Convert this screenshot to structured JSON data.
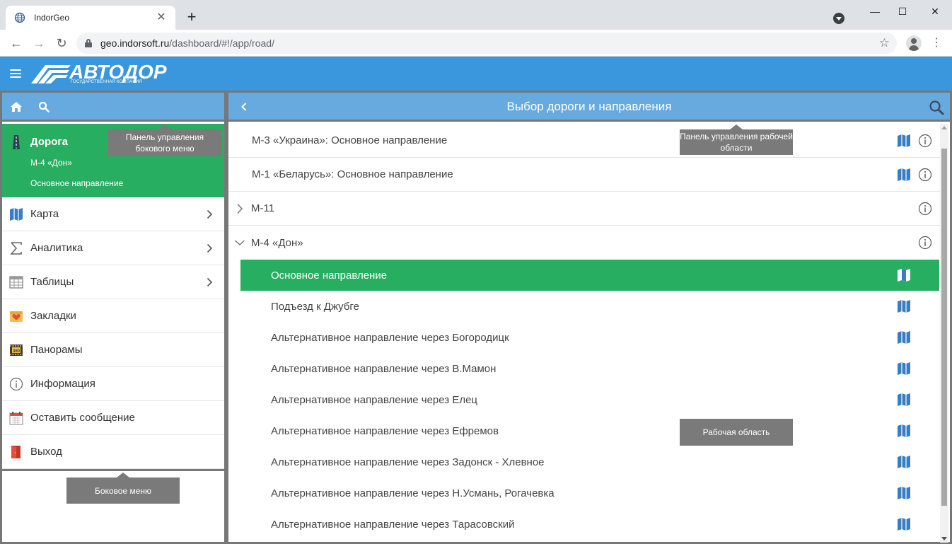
{
  "browser": {
    "tab_title": "IndorGeo",
    "tab_close": "✕",
    "new_tab": "+",
    "url_host": "geo.indorsoft.ru",
    "url_path": "/dashboard/#!/app/road/",
    "win_minimize": "—",
    "win_maximize": "☐",
    "win_close": "✕",
    "back": "←",
    "forward": "→",
    "reload": "↻",
    "star": "☆",
    "kebab": "⋮"
  },
  "app": {
    "logo_text": "АВТОДОР",
    "logo_sub": "ГОСУДАРСТВЕННАЯ КОМПАНИЯ",
    "brand_color": "#3b97dd",
    "accent_color": "#27ae60"
  },
  "sidebar": {
    "road_card": {
      "title": "Дорога",
      "road": "М-4 «Дон»",
      "direction": "Основное направление"
    },
    "items": [
      {
        "label": "Карта",
        "icon": "map-icon",
        "has_chevron": true
      },
      {
        "label": "Аналитика",
        "icon": "sigma-icon",
        "has_chevron": true
      },
      {
        "label": "Таблицы",
        "icon": "table-icon",
        "has_chevron": true
      },
      {
        "label": "Закладки",
        "icon": "bookmark-heart-icon",
        "has_chevron": false
      },
      {
        "label": "Панорамы",
        "icon": "panorama-360-icon",
        "has_chevron": false
      },
      {
        "label": "Информация",
        "icon": "info-icon",
        "has_chevron": false
      },
      {
        "label": "Оставить сообщение",
        "icon": "calendar-icon",
        "has_chevron": false
      },
      {
        "label": "Выход",
        "icon": "exit-door-icon",
        "has_chevron": false
      }
    ]
  },
  "main": {
    "title": "Выбор дороги и направления",
    "roads": [
      {
        "label": "М-3 «Украина»: Основное направление",
        "has_map": true,
        "has_info": true
      },
      {
        "label": "М-1 «Беларусь»: Основное направление",
        "has_map": true,
        "has_info": true
      },
      {
        "label": "М-11",
        "expand": "collapsed",
        "has_map": false,
        "has_info": true
      },
      {
        "label": "М-4 «Дон»",
        "expand": "expanded",
        "has_map": false,
        "has_info": true
      }
    ],
    "directions": [
      {
        "label": "Основное направление",
        "active": true
      },
      {
        "label": "Подъезд к Джубге",
        "active": false
      },
      {
        "label": "Альтернативное направление через Богородицк",
        "active": false
      },
      {
        "label": "Альтернативное направление через В.Мамон",
        "active": false
      },
      {
        "label": "Альтернативное направление через Елец",
        "active": false
      },
      {
        "label": "Альтернативное направление через Ефремов",
        "active": false
      },
      {
        "label": "Альтернативное направление через Задонск - Хлевное",
        "active": false
      },
      {
        "label": "Альтернативное направление через Н.Усмань, Рогачевка",
        "active": false
      },
      {
        "label": "Альтернативное направление через Тарасовский",
        "active": false
      }
    ]
  },
  "callouts": {
    "sidebar_panel": "Панель управления бокового меню",
    "work_panel": "Панель управления рабочей области",
    "work_area": "Рабочая область",
    "side_menu": "Боковое меню"
  }
}
